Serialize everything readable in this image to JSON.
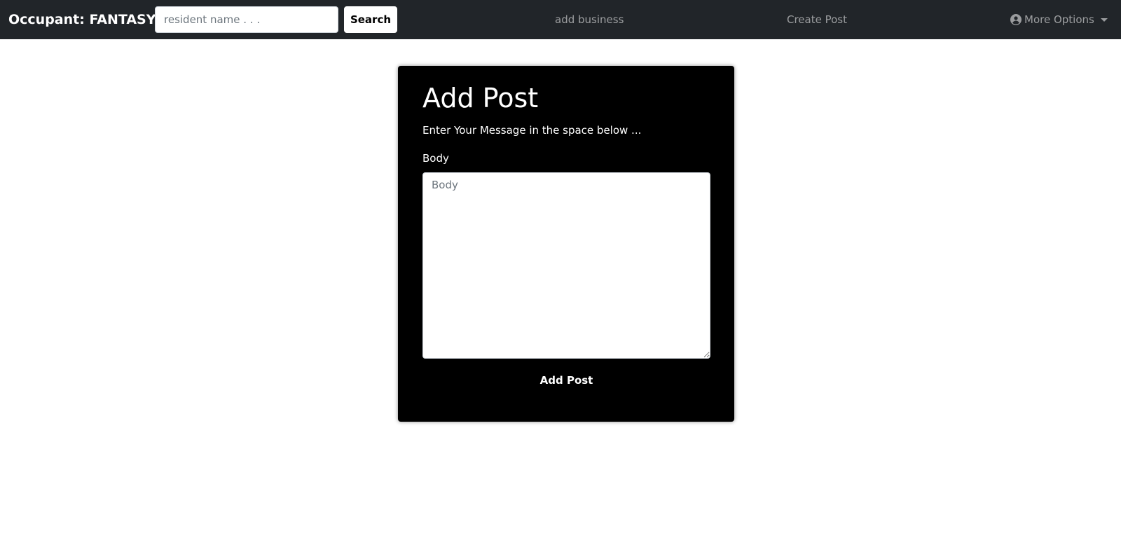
{
  "navbar": {
    "brand": "Occupant: FANTASY",
    "search": {
      "placeholder": "resident name . . .",
      "value": "",
      "button_label": "Search"
    },
    "links": {
      "add_business": "add business",
      "create_post": "Create Post"
    },
    "more_options": {
      "label": "More Options",
      "icon": "user-circle-icon"
    }
  },
  "form": {
    "title": "Add Post",
    "subtitle": "Enter Your Message in the space below ...",
    "body_label": "Body",
    "body_placeholder": "Body",
    "body_value": "",
    "submit_label": "Add Post"
  },
  "colors": {
    "navbar_bg": "#212529",
    "card_bg": "#000000",
    "page_bg": "#ffffff",
    "nav_link": "rgba(255,255,255,0.55)"
  }
}
